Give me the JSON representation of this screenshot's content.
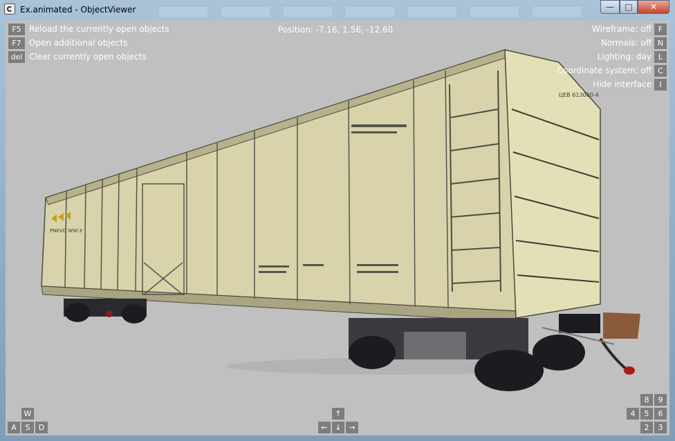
{
  "window": {
    "title": "Ex.animated - ObjectViewer",
    "controls": {
      "minimize": "—",
      "maximize": "□",
      "close": "✕"
    }
  },
  "hud": {
    "position_text": "Position: -7.16, 1.56, -12.60",
    "left_commands": [
      {
        "key": "F5",
        "label": "Reload the currently open objects"
      },
      {
        "key": "F7",
        "label": "Open additional objects"
      },
      {
        "key": "del",
        "label": "Clear currently open objects"
      }
    ],
    "right_toggles": [
      {
        "key": "F",
        "label": "Wireframe: off"
      },
      {
        "key": "N",
        "label": "Normals: off"
      },
      {
        "key": "L",
        "label": "Lighting: day"
      },
      {
        "key": "C",
        "label": "Coordinate system: off"
      },
      {
        "key": "I",
        "label": "Hide interface"
      }
    ],
    "wasd_keys": {
      "up": "W",
      "left": "A",
      "down": "S",
      "right": "D"
    },
    "arrow_keys": {
      "up": "↑",
      "left": "←",
      "down": "↓",
      "right": "→"
    },
    "numpad_keys": {
      "k8": "8",
      "k9": "9",
      "k4": "4",
      "k5": "5",
      "k6": "6",
      "k2": "2",
      "k3": "3"
    }
  },
  "model": {
    "side_marking": "PNEVO WW-3",
    "end_marking": "ЦЕВ 613000-4",
    "colors": {
      "body": "#d8d3ab",
      "shadow": "#8c8a6a",
      "line": "#4a4a3a",
      "wheel": "#1c1c20"
    }
  }
}
